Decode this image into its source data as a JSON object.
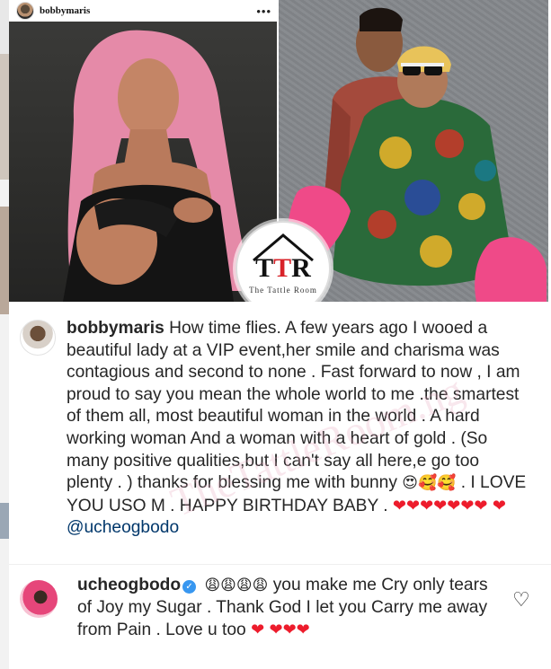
{
  "header": {
    "username": "bobbymaris",
    "more_icon": "more-options-icon"
  },
  "logo": {
    "letters_left": "T",
    "letters_mid": "T",
    "letters_right": "R",
    "subtitle": "The Tattle Room"
  },
  "watermark": "TheTattleRoom.ng",
  "post": {
    "caption_user": "bobbymaris",
    "caption_text_1": "How time flies. A few years ago I wooed a beautiful lady at a VIP event,her smile and charisma was contagious and second to none . Fast forward to now , I am proud to say you mean the whole world to me .the smartest of them all, most beautiful woman in the world . A hard working woman And a woman with a heart of gold . (So many positive qualities,but  I can't say all here,e go too plenty . ) thanks for blessing me with bunny",
    "caption_emojis": "😍🥰🥰",
    "caption_text_2": ". I LOVE YOU USO M . HAPPY BIRTHDAY BABY .",
    "caption_hearts": "❤❤❤❤❤❤❤",
    "caption_heart_last": "❤",
    "mention": "@ucheogbodo"
  },
  "reply": {
    "user": "ucheogbodo",
    "verified": "✓",
    "emojis": "😩😩😩😩",
    "text": "you make me Cry only tears of Joy my Sugar . Thank God I let you Carry me away from Pain . Love u too",
    "heart_inline": "❤",
    "hearts_end": "❤❤❤",
    "like_icon": "heart-outline-icon"
  },
  "colors": {
    "mention": "#00376b",
    "heart": "#ed1c2c",
    "verified": "#3897f0"
  }
}
